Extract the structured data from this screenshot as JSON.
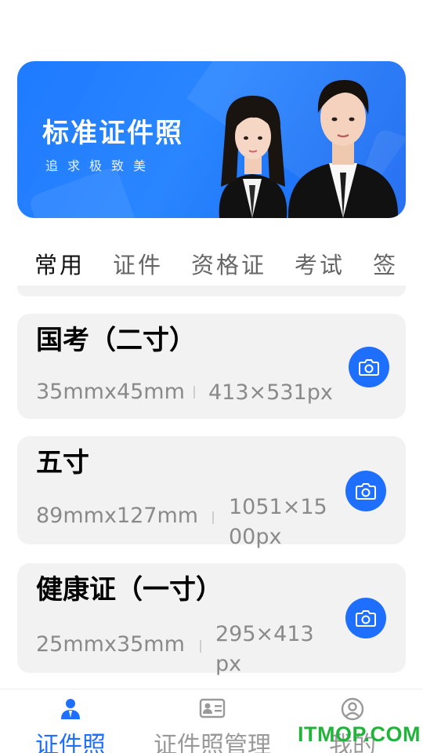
{
  "banner": {
    "title": "标准证件照",
    "subtitle": "追求极致美"
  },
  "tabs": [
    {
      "label": "常用",
      "active": true
    },
    {
      "label": "证件",
      "active": false
    },
    {
      "label": "资格证",
      "active": false
    },
    {
      "label": "考试",
      "active": false
    },
    {
      "label": "签",
      "active": false
    }
  ],
  "cards": [
    {
      "title": "国考（二寸）",
      "size_mm": "35mmx45mm",
      "size_px": "413×531px"
    },
    {
      "title": "五寸",
      "size_mm": "89mmx127mm",
      "size_px": "1051×1500px"
    },
    {
      "title": "健康证（一寸）",
      "size_mm": "25mmx35mm",
      "size_px": "295×413px"
    }
  ],
  "bottom_nav": [
    {
      "label": "证件照",
      "icon": "person-icon",
      "active": true
    },
    {
      "label": "证件照管理",
      "icon": "id-card-icon",
      "active": false
    },
    {
      "label": "我的",
      "icon": "profile-icon",
      "active": false
    }
  ],
  "watermark": "ITMOP.COM",
  "colors": {
    "accent": "#1f6fff",
    "inactive": "#999999",
    "card_bg": "#f2f2f2",
    "watermark": "#22b43a"
  }
}
